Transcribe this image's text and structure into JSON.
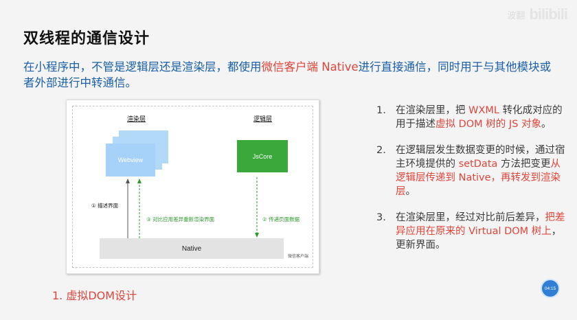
{
  "slide": {
    "title": "双线程的通信设计",
    "watermark_text": "波翻",
    "watermark_logo": "bilibili",
    "intro_part1": "在小程序中，不管是逻辑层还是渲染层，都使用",
    "intro_highlight": "微信客户端 Native",
    "intro_part2": "进行直接通信，同时用于与其他模块或者外部进行中转通信。",
    "bottom_item": "1.  虚拟DOM设计",
    "timer": "04:15"
  },
  "diagram": {
    "render_layer_label": "渲染层",
    "logic_layer_label": "逻辑层",
    "webview_label": "Webview",
    "jscore_label": "JsCore",
    "native_label": "Native",
    "wechat_client_label": "微信客户端",
    "arrow1_label": "① 描述界面",
    "arrow2_label": "② 传递页面数据",
    "arrow3_label": "③ 对比应用差异重新渲染界面"
  },
  "points": [
    {
      "num": "1.",
      "segments": [
        {
          "text": "在渲染层里，把 ",
          "red": false
        },
        {
          "text": "WXML",
          "red": true
        },
        {
          "text": " 转化成对应的用于描述",
          "red": false
        },
        {
          "text": "虚拟 DOM 树的 JS 对象",
          "red": true
        },
        {
          "text": "。",
          "red": false
        }
      ]
    },
    {
      "num": "2.",
      "segments": [
        {
          "text": "在逻辑层发生数据变更的时候，通过宿主环境提供的 ",
          "red": false
        },
        {
          "text": "setData",
          "red": true
        },
        {
          "text": " 方法把变更",
          "red": false
        },
        {
          "text": "从逻辑层传递到 Native，再转发到渲染层",
          "red": true
        },
        {
          "text": "。",
          "red": false
        }
      ]
    },
    {
      "num": "3.",
      "segments": [
        {
          "text": "在渲染层里，经过对比前后差异，",
          "red": false
        },
        {
          "text": "把差异应用在原来的 Virtual DOM 树上",
          "red": true
        },
        {
          "text": "，更新界面。",
          "red": false
        }
      ]
    }
  ],
  "colors": {
    "accent_blue": "#1a5fa8",
    "highlight_red": "#e0453b",
    "webview_blue": "#a6d1f8",
    "jscore_green": "#3aa83a",
    "arrow_green": "#2e9a2e"
  }
}
